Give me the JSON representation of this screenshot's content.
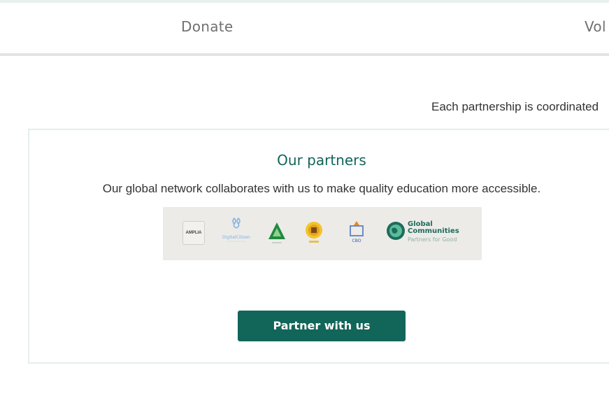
{
  "nav": {
    "donate_label": "Donate",
    "volunteer_label": "Vol"
  },
  "intro": {
    "text": "Each partnership is coordinated"
  },
  "partners": {
    "title": "Our partners",
    "description": "Our global network collaborates with us to make quality education more accessible.",
    "logos": [
      {
        "name": "amplia",
        "label": "AMPLIA"
      },
      {
        "name": "digital-citizen",
        "label": "DigitalCitizen"
      },
      {
        "name": "green-triangle",
        "label": ""
      },
      {
        "name": "emblem",
        "label": ""
      },
      {
        "name": "cbo",
        "label": "CBO"
      },
      {
        "name": "global-communities",
        "label": "Global Communities",
        "sub": "Partners for Good"
      }
    ],
    "cta_label": "Partner with us"
  },
  "colors": {
    "brand": "#126559",
    "text": "#333333",
    "nav_text": "#707070"
  }
}
